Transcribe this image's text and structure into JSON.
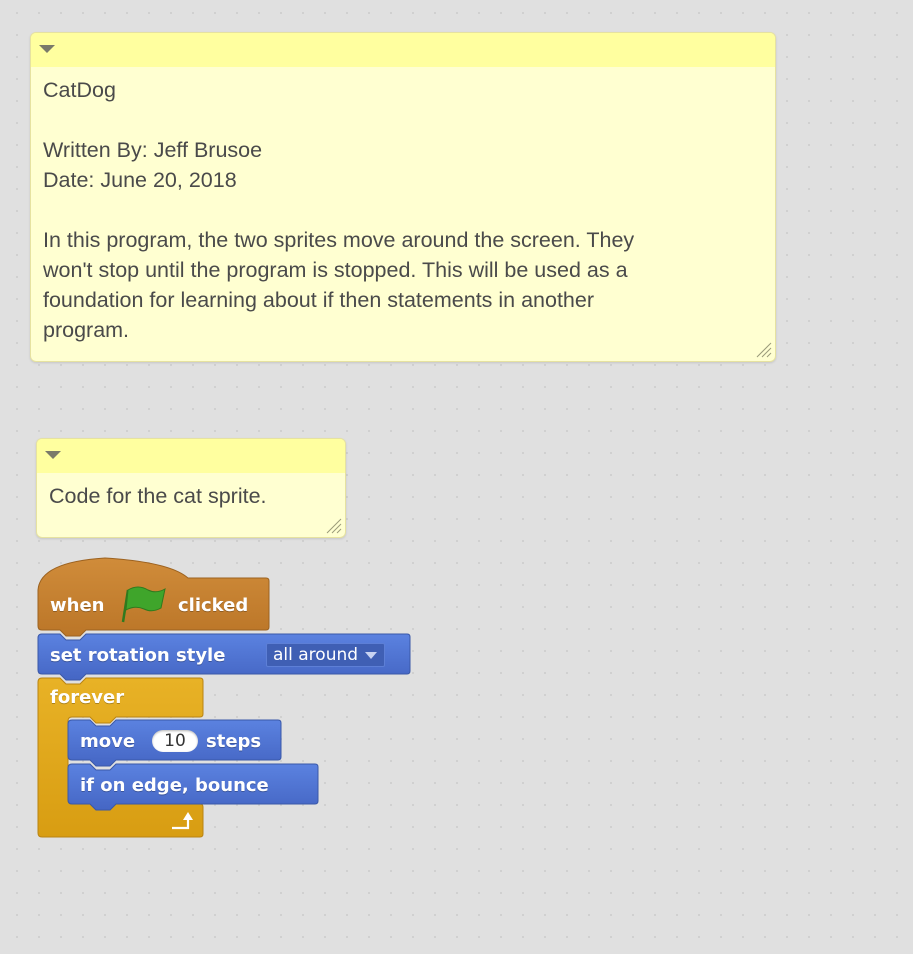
{
  "comments": [
    {
      "text": "CatDog\n\nWritten By: Jeff Brusoe\nDate: June 20, 2018\n\nIn this program, the two sprites move around the screen. They\nwon't stop until the program is stopped. This will be used as a\nfoundation for learning about if then statements in another\nprogram."
    },
    {
      "text": "Code for the cat sprite."
    }
  ],
  "script": {
    "hat": {
      "when_label": "when",
      "clicked_label": "clicked",
      "icon": "green-flag-icon"
    },
    "rotation": {
      "label": "set rotation style",
      "dropdown_value": "all around"
    },
    "forever": {
      "label": "forever",
      "icon": "loop-arrow-icon"
    },
    "move": {
      "move_label": "move",
      "steps_value": "10",
      "steps_label": "steps"
    },
    "bounce": {
      "label": "if on edge, bounce"
    }
  },
  "colors": {
    "workspace": "#e0e0e0",
    "comment_body": "#ffffd1",
    "comment_header": "#ffff9f",
    "events": "#c88330",
    "motion": "#4a6cd4",
    "control": "#e1a91a"
  }
}
